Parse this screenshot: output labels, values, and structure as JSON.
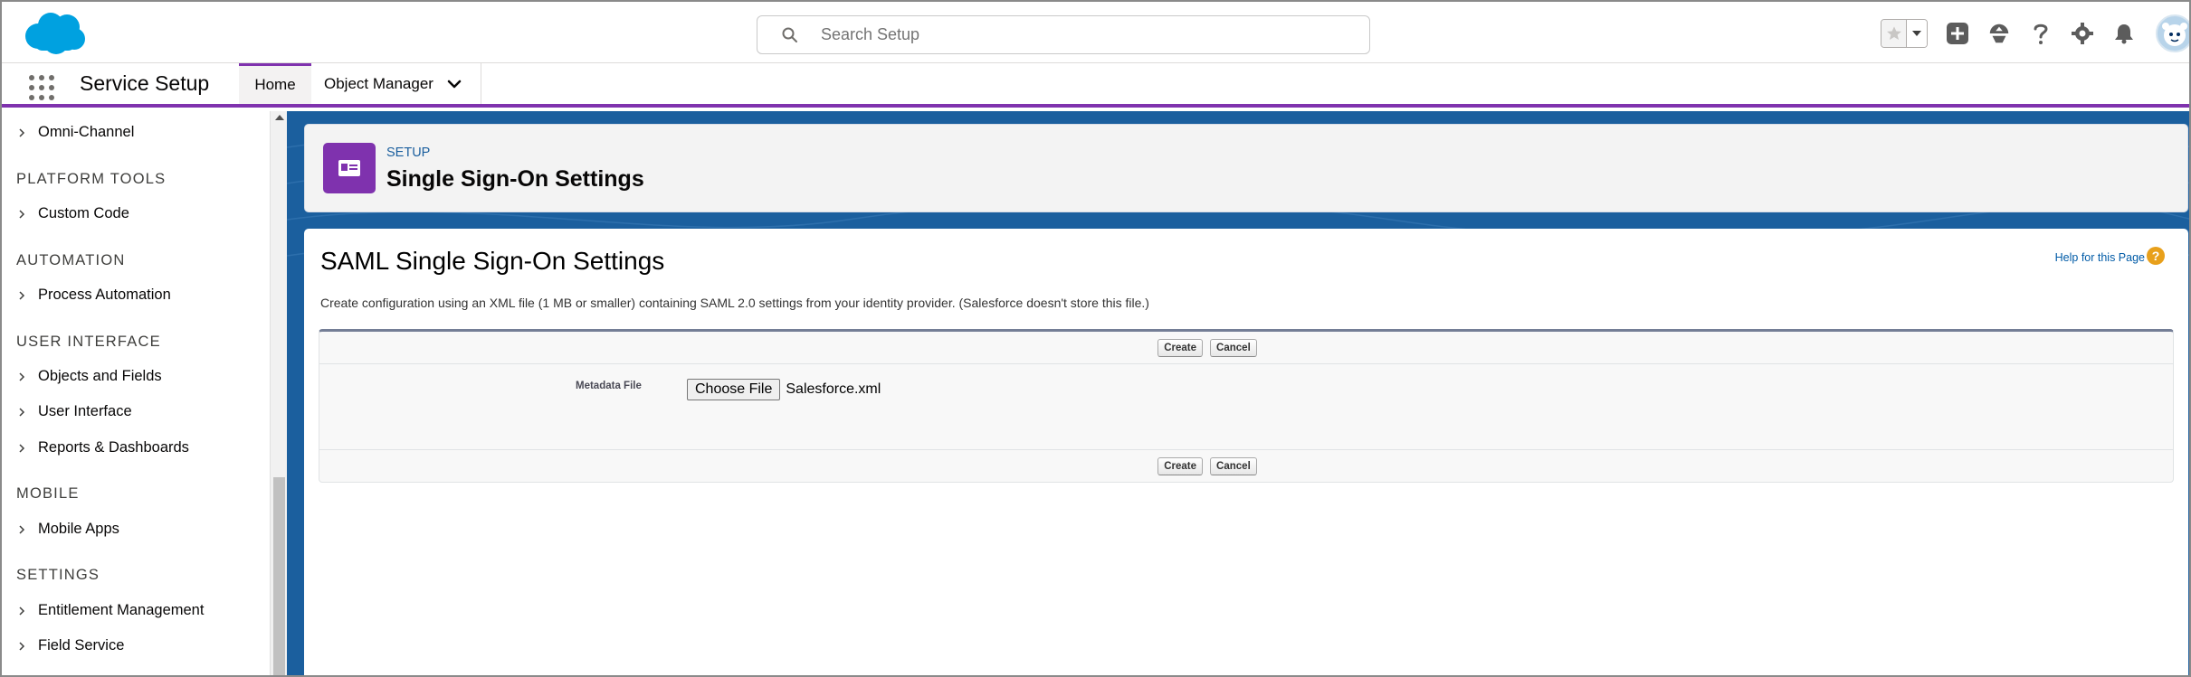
{
  "header": {
    "search_placeholder": "Search Setup"
  },
  "nav": {
    "app_name": "Service Setup",
    "tabs": [
      {
        "label": "Home",
        "active": true
      },
      {
        "label": "Object Manager",
        "active": false
      }
    ]
  },
  "sidebar": {
    "entries": [
      {
        "type": "item",
        "label": "Omni-Channel"
      },
      {
        "type": "section",
        "label": "PLATFORM TOOLS"
      },
      {
        "type": "item",
        "label": "Custom Code"
      },
      {
        "type": "section",
        "label": "AUTOMATION"
      },
      {
        "type": "item",
        "label": "Process Automation"
      },
      {
        "type": "section",
        "label": "USER INTERFACE"
      },
      {
        "type": "item",
        "label": "Objects and Fields"
      },
      {
        "type": "item",
        "label": "User Interface"
      },
      {
        "type": "item",
        "label": "Reports & Dashboards"
      },
      {
        "type": "section",
        "label": "MOBILE"
      },
      {
        "type": "item",
        "label": "Mobile Apps"
      },
      {
        "type": "section",
        "label": "SETTINGS"
      },
      {
        "type": "item",
        "label": "Entitlement Management"
      },
      {
        "type": "item",
        "label": "Field Service"
      }
    ]
  },
  "page_header": {
    "breadcrumb": "SETUP",
    "title": "Single Sign-On Settings"
  },
  "content": {
    "title": "SAML Single Sign-On Settings",
    "help_link": "Help for this Page",
    "description": "Create configuration using an XML file (1 MB or smaller) containing SAML 2.0 settings from your identity provider. (Salesforce doesn't store this file.)",
    "buttons": {
      "create": "Create",
      "cancel": "Cancel"
    },
    "field_label": "Metadata File",
    "choose_file_label": "Choose File",
    "chosen_file": "Salesforce.xml"
  },
  "colors": {
    "accent_purple": "#7f32ae",
    "brand_blue": "#1b5f9e",
    "salesforce_cloud": "#00a1e0",
    "help_orange": "#e8a01b"
  }
}
